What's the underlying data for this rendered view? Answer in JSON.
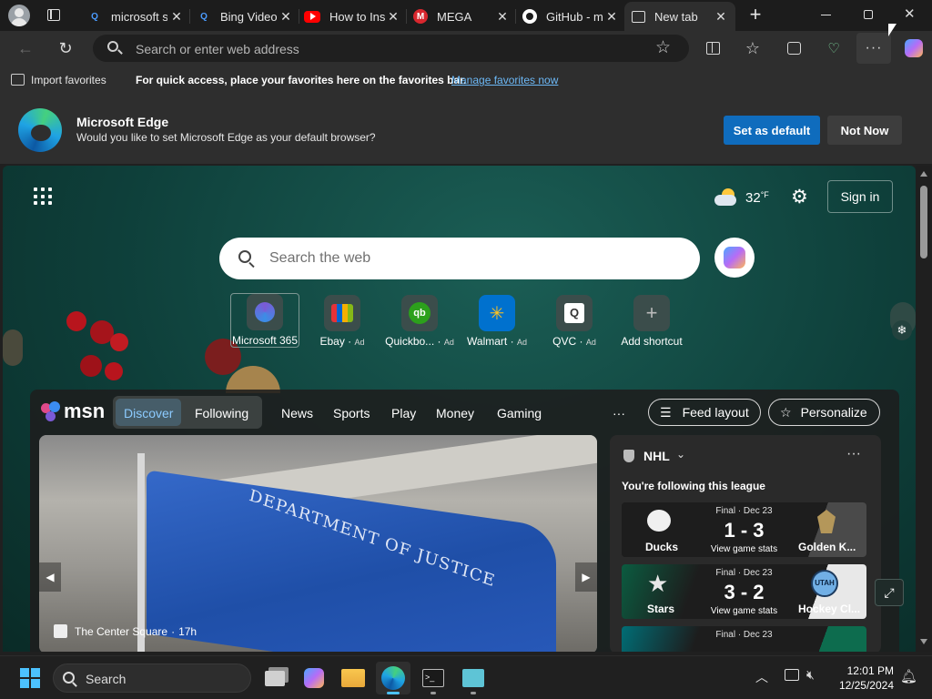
{
  "tabs": [
    {
      "label": "microsoft s",
      "icon": "bing-search-icon"
    },
    {
      "label": "Bing Video",
      "icon": "bing-search-icon"
    },
    {
      "label": "How to Ins",
      "icon": "youtube-icon"
    },
    {
      "label": "MEGA",
      "icon": "mega-icon"
    },
    {
      "label": "GitHub - m",
      "icon": "github-icon"
    },
    {
      "label": "New tab",
      "icon": "new-tab-icon",
      "active": true
    }
  ],
  "address_bar": {
    "placeholder": "Search or enter web address"
  },
  "favorites_bar": {
    "import_label": "Import favorites",
    "message": "For quick access, place your favorites here on the favorites bar.",
    "manage_link": "Manage favorites now"
  },
  "banner": {
    "title": "Microsoft Edge",
    "subtitle": "Would you like to set Microsoft Edge as your default browser?",
    "set_default": "Set as default",
    "not_now": "Not Now"
  },
  "newtab": {
    "weather": {
      "temp": "32",
      "unit": "°F",
      "icon": "partly-cloudy-icon"
    },
    "sign_in": "Sign in",
    "search_placeholder": "Search the web",
    "shortcuts": [
      {
        "label": "Microsoft 365",
        "ad": "",
        "icon": "microsoft-365-icon",
        "color": "#7b5ad6"
      },
      {
        "label": "Ebay",
        "ad": "Ad",
        "icon": "ebay-icon",
        "color": "#e53238"
      },
      {
        "label": "Quickbo...",
        "ad": "Ad",
        "icon": "quickbooks-icon",
        "color": "#2ca01c"
      },
      {
        "label": "Walmart",
        "ad": "Ad",
        "icon": "walmart-icon",
        "color": "#0071ce"
      },
      {
        "label": "QVC",
        "ad": "Ad",
        "icon": "qvc-icon",
        "color": "#ffffff"
      },
      {
        "label": "Add shortcut",
        "ad": "",
        "icon": "plus-icon",
        "color": "#9e9e9e"
      }
    ]
  },
  "msn": {
    "logo": "msn",
    "nav": [
      "Discover",
      "Following",
      "News",
      "Sports",
      "Play",
      "Money",
      "Gaming"
    ],
    "more": "···",
    "feed_layout": "Feed layout",
    "personalize": "Personalize",
    "hero": {
      "source": "The Center Square",
      "age": "17h",
      "flag_text": "DEPARTMENT OF JUSTICE"
    },
    "nhl": {
      "title": "NHL",
      "following": "You're following this league",
      "games": [
        {
          "status": "Final · Dec 23",
          "score": "1 - 3",
          "link": "View game stats",
          "home": "Ducks",
          "away": "Golden K...",
          "home_color": "#f47a38",
          "away_color": "#b4975a"
        },
        {
          "status": "Final · Dec 23",
          "score": "3 - 2",
          "link": "View game stats",
          "home": "Stars",
          "away": "Hockey Cl...",
          "home_color": "#006847",
          "away_color": "#71afe5"
        },
        {
          "status": "Final · Dec 23",
          "score": "",
          "link": "",
          "home": "",
          "away": "",
          "home_color": "#006d75",
          "away_color": "#00205b"
        }
      ]
    }
  },
  "taskbar": {
    "search_label": "Search",
    "time": "12:01 PM",
    "date": "12/25/2024"
  }
}
